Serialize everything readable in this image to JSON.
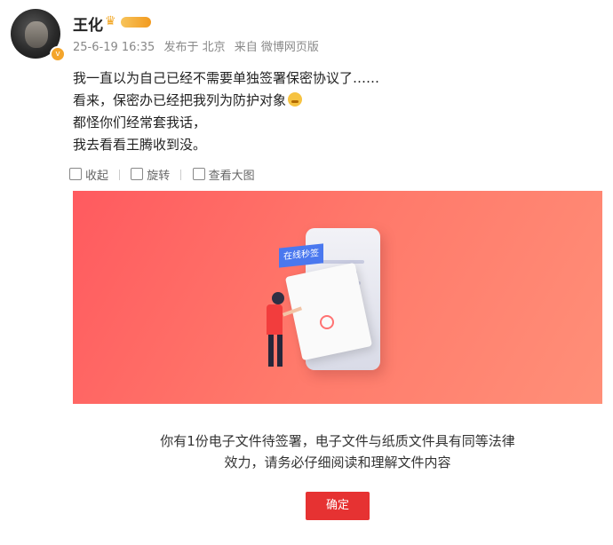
{
  "post": {
    "username": "王化",
    "meta": {
      "time": "25-6-19 16:35",
      "location": "发布于 北京",
      "source": "来自 微博网页版"
    },
    "lines": [
      "我一直以为自己已经不需要单独签署保密协议了……",
      "看来，保密办已经把我列为防护对象",
      "都怪你们经常套我话，",
      "我去看看王腾收到没。"
    ],
    "emoji_icon": "crying-emoji-icon"
  },
  "toolbar": {
    "collapse_label": "收起",
    "rotate_label": "旋转",
    "view_large_label": "查看大图"
  },
  "image": {
    "tag_text": "在线秒签",
    "message_line1": "你有1份电子文件待签署，电子文件与纸质文件具有同等法律",
    "message_line2": "效力，请务必仔细阅读和理解文件内容",
    "confirm_label": "确定"
  },
  "colors": {
    "banner_start": "#ff5a5f",
    "banner_end": "#ff8f78",
    "confirm_button": "#e63232",
    "tag": "#4a78ef"
  }
}
